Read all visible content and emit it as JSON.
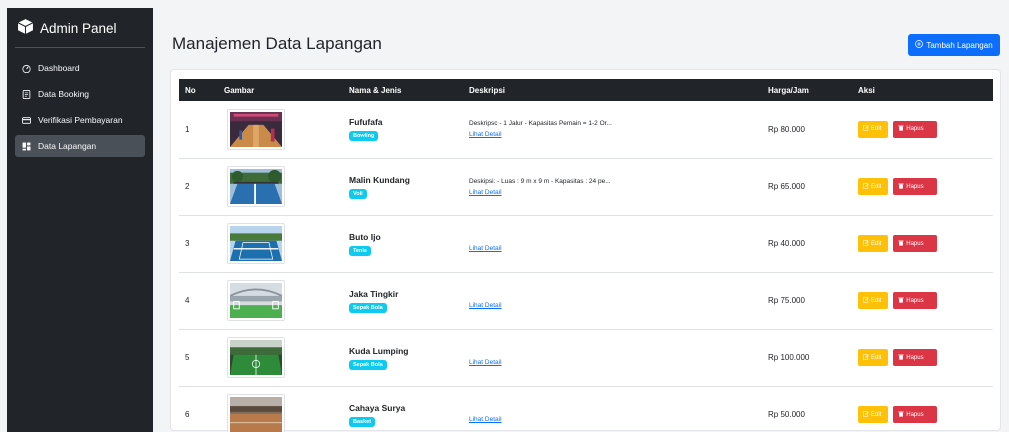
{
  "sidebar": {
    "brand": "Admin Panel",
    "items": [
      {
        "label": "Dashboard",
        "icon": "speedometer-icon"
      },
      {
        "label": "Data Booking",
        "icon": "list-icon"
      },
      {
        "label": "Verifikasi Pembayaran",
        "icon": "card-icon"
      },
      {
        "label": "Data Lapangan",
        "icon": "grid-icon",
        "active": true
      }
    ]
  },
  "header": {
    "title": "Manajemen Data Lapangan",
    "add_button": "Tambah Lapangan"
  },
  "table": {
    "columns": [
      "No",
      "Gambar",
      "Nama & Jenis",
      "Deskripsi",
      "Harga/Jam",
      "Aksi"
    ],
    "edit_label": "Edit",
    "delete_label": "Hapus",
    "detail_label": "Lihat Detail",
    "rows": [
      {
        "no": "1",
        "name": "Fufufafa",
        "type": "Bowling",
        "desc": "Deskripsc - 1 Jalur - Kapasitas Pemain = 1-2 Or...",
        "price": "Rp 80.000"
      },
      {
        "no": "2",
        "name": "Malin Kundang",
        "type": "Voli",
        "desc": "Deskipsi: - Luas : 9 m x 9 m - Kapasitas : 24 pe...",
        "price": "Rp 65.000"
      },
      {
        "no": "3",
        "name": "Buto Ijo",
        "type": "Tenis",
        "desc": "",
        "price": "Rp 40.000"
      },
      {
        "no": "4",
        "name": "Jaka Tingkir",
        "type": "Sepak Bola",
        "desc": "",
        "price": "Rp 75.000"
      },
      {
        "no": "5",
        "name": "Kuda Lumping",
        "type": "Sepak Bola",
        "desc": "",
        "price": "Rp 100.000"
      },
      {
        "no": "6",
        "name": "Cahaya Surya",
        "type": "Basket",
        "desc": "",
        "price": "Rp 50.000"
      }
    ]
  }
}
